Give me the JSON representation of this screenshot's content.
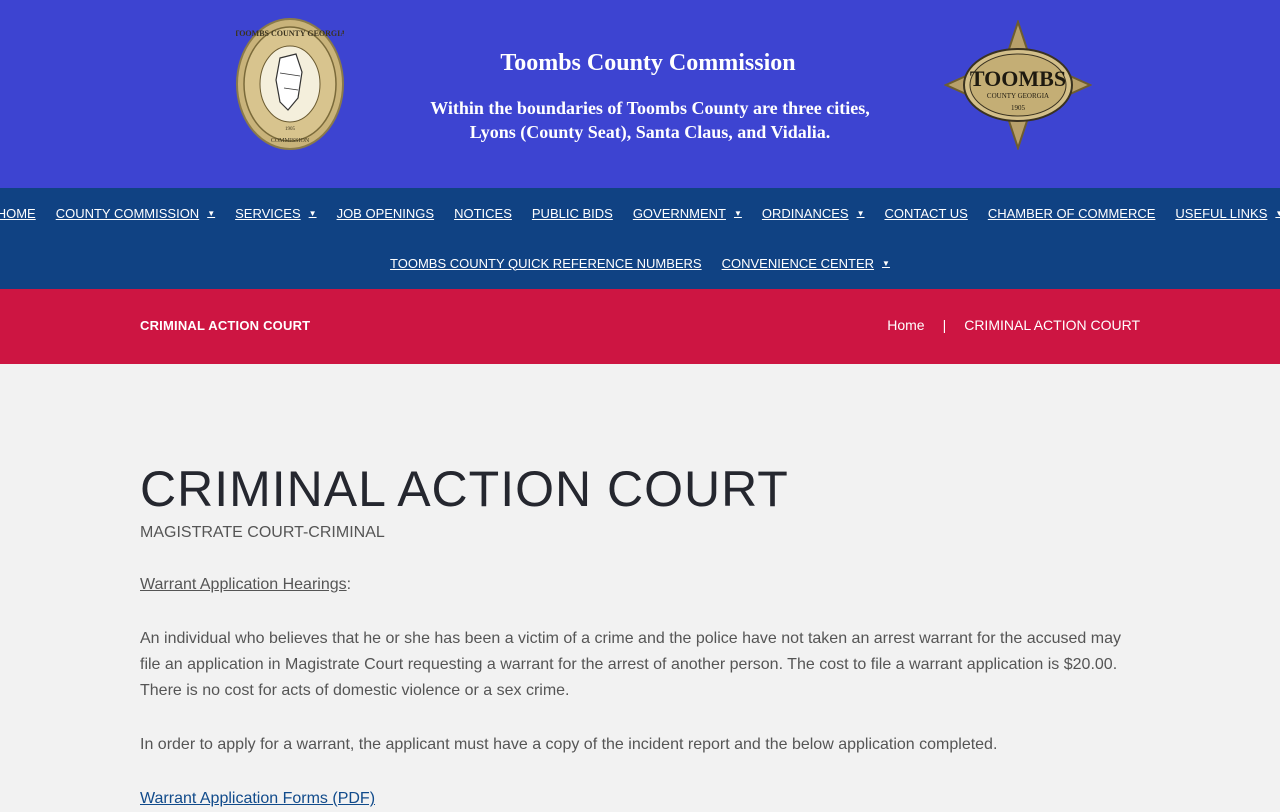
{
  "banner": {
    "title": "Toombs County Commission",
    "subtitle_line1": "Within the boundaries of Toombs County are three cities,",
    "subtitle_line2": "Lyons (County Seat), Santa Claus, and Vidalia.",
    "seal_left_text": "TOOMBS COUNTY GEORGIA",
    "seal_left_bottom": "COMMISSION",
    "seal_left_year": "1905",
    "seal_right_text": "TOOMBS",
    "seal_right_sub": "COUNTY GEORGIA",
    "seal_right_year": "1905"
  },
  "nav": {
    "row1": [
      {
        "label": "HOME",
        "caret": false
      },
      {
        "label": "COUNTY COMMISSION",
        "caret": true
      },
      {
        "label": "SERVICES",
        "caret": true
      },
      {
        "label": "JOB OPENINGS",
        "caret": false
      },
      {
        "label": "NOTICES",
        "caret": false
      },
      {
        "label": "PUBLIC BIDS",
        "caret": false
      },
      {
        "label": "GOVERNMENT",
        "caret": true
      },
      {
        "label": "ORDINANCES",
        "caret": true
      },
      {
        "label": "CONTACT US",
        "caret": false
      },
      {
        "label": "CHAMBER OF COMMERCE",
        "caret": false
      },
      {
        "label": "USEFUL LINKS",
        "caret": true
      }
    ],
    "row2": [
      {
        "label": "TOOMBS COUNTY QUICK REFERENCE NUMBERS",
        "caret": false
      },
      {
        "label": "CONVENIENCE CENTER",
        "caret": true
      }
    ],
    "caret_glyph": "▼"
  },
  "titlebar": {
    "title": "CRIMINAL ACTION COURT",
    "crumb_home": "Home",
    "crumb_sep": "|",
    "crumb_current": "CRIMINAL ACTION COURT"
  },
  "content": {
    "title": "CRIMINAL ACTION COURT",
    "subtitle": "MAGISTRATE COURT-CRIMINAL",
    "hearings_link": "Warrant Application Hearings",
    "hearings_colon": ":",
    "para1": "An individual who believes that he or she has been a victim of a crime and the police have not taken an arrest warrant for the accused may file an application in Magistrate Court requesting a warrant for the arrest of another person. The cost to file a warrant application is $20.00. There is no cost for acts of domestic violence or a sex crime.",
    "para2": "In order to apply for a warrant, the applicant must have a copy of the incident report and the below application completed.",
    "forms_link": "Warrant Application Forms (PDF)"
  },
  "colors": {
    "banner_bg": "#3d44d1",
    "nav_bg": "#104283",
    "titlebar_bg": "#cd1542",
    "page_bg": "#f2f2f2",
    "link_blue": "#114b8b"
  }
}
